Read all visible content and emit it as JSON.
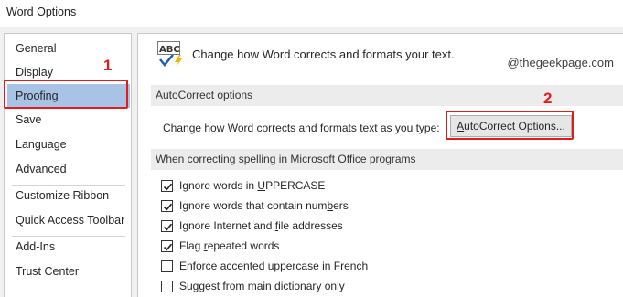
{
  "window": {
    "title": "Word Options"
  },
  "nav": {
    "items": [
      {
        "label": "General",
        "selected": false
      },
      {
        "label": "Display",
        "selected": false
      },
      {
        "label": "Proofing",
        "selected": true
      },
      {
        "label": "Save",
        "selected": false
      },
      {
        "label": "Language",
        "selected": false
      },
      {
        "label": "Advanced",
        "selected": false
      },
      {
        "label": "Customize Ribbon",
        "selected": false
      },
      {
        "label": "Quick Access Toolbar",
        "selected": false
      },
      {
        "label": "Add-Ins",
        "selected": false
      },
      {
        "label": "Trust Center",
        "selected": false
      }
    ]
  },
  "annotations": {
    "step1": "1",
    "step2": "2",
    "color": "#e31b1b"
  },
  "main": {
    "header_icon": "abc-spellcheck-icon",
    "header_text": "Change how Word corrects and formats your text.",
    "watermark": "@thegeekpage.com",
    "autocorrect_section": {
      "title": "AutoCorrect options",
      "description": "Change how Word corrects and formats text as you type:",
      "button_label": "AutoCorrect Options..."
    },
    "spelling_section": {
      "title": "When correcting spelling in Microsoft Office programs",
      "options": [
        {
          "pre": "Ignore words in ",
          "u": "U",
          "post": "PPERCASE",
          "checked": true
        },
        {
          "pre": "Ignore words that contain num",
          "u": "b",
          "post": "ers",
          "checked": true
        },
        {
          "pre": "Ignore Internet and ",
          "u": "f",
          "post": "ile addresses",
          "checked": true
        },
        {
          "pre": "Flag ",
          "u": "r",
          "post": "epeated words",
          "checked": true
        },
        {
          "pre": "Enforce accented uppercase in French",
          "u": "",
          "post": "",
          "checked": false
        },
        {
          "pre": "Suggest from main dictionary only",
          "u": "",
          "post": "",
          "checked": false
        }
      ]
    }
  },
  "colors": {
    "selected_nav": "#a9c3e6",
    "section_bar": "#ececec"
  }
}
